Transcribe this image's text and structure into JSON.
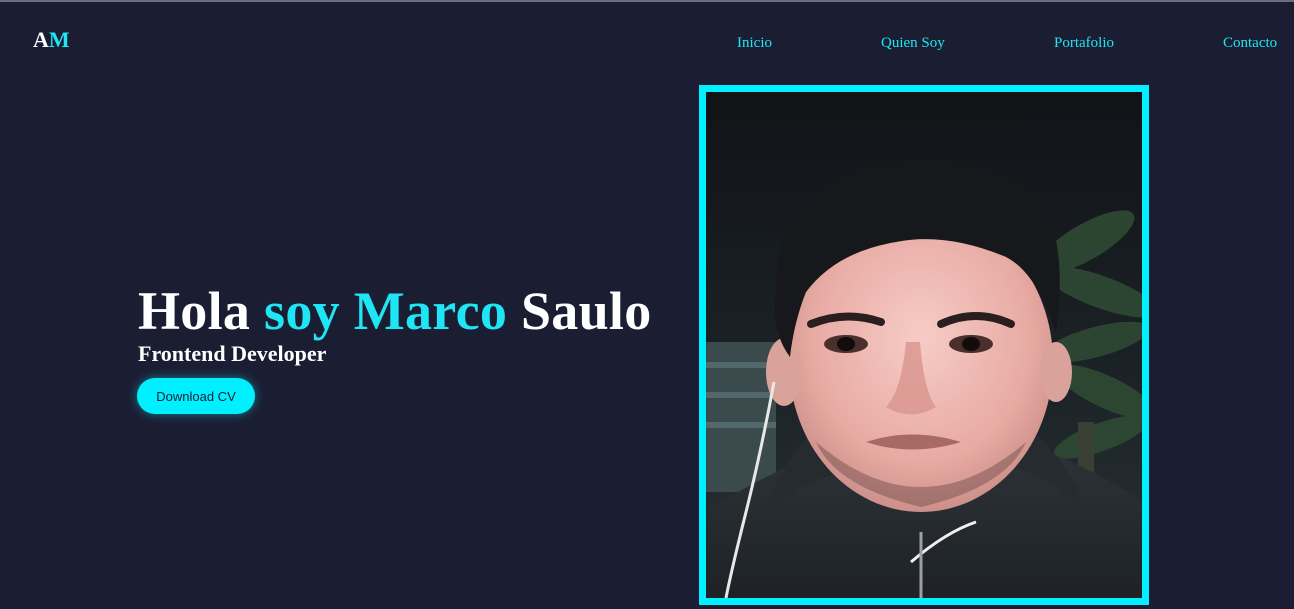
{
  "logo": {
    "first": "A",
    "second": "M"
  },
  "nav": {
    "items": [
      {
        "label": "Inicio"
      },
      {
        "label": "Quien Soy"
      },
      {
        "label": "Portafolio"
      },
      {
        "label": "Contacto"
      }
    ]
  },
  "hero": {
    "title_part1": "Hola ",
    "title_part2": "soy Marco",
    "title_part3": " Saulo",
    "subtitle": "Frontend Developer",
    "button_label": "Download CV"
  },
  "colors": {
    "background": "#1b1d33",
    "accent": "#00f0ff",
    "text": "#ffffff"
  }
}
